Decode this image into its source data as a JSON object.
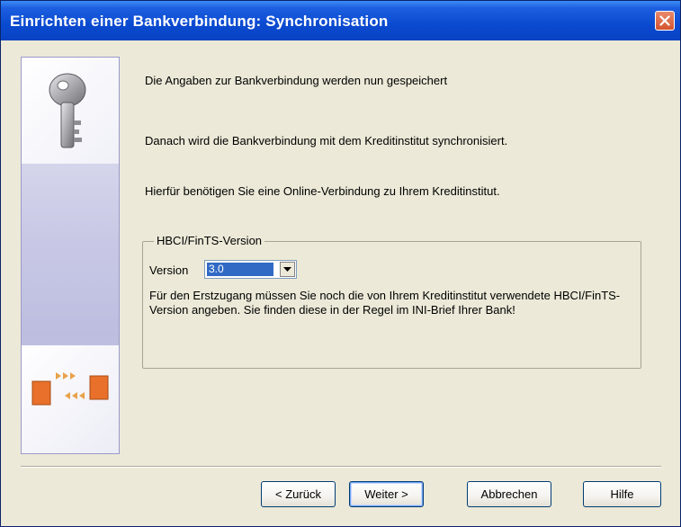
{
  "window": {
    "title": "Einrichten einer Bankverbindung: Synchronisation"
  },
  "icons": {
    "close": "close-icon",
    "key": "key-icon",
    "transfer": "transfer-arrows-icon",
    "dropdown": "chevron-down-icon"
  },
  "content": {
    "line1": "Die Angaben zur Bankverbindung werden nun gespeichert",
    "line2": "Danach wird die Bankverbindung mit dem Kreditinstitut synchronisiert.",
    "line3": "Hierfür benötigen Sie eine Online-Verbindung zu Ihrem Kreditinstitut."
  },
  "group": {
    "legend": "HBCI/FinTS-Version",
    "version_label": "Version",
    "version_value": "3.0",
    "note": "Für den Erstzugang müssen Sie noch die von Ihrem Kreditinstitut verwendete HBCI/FinTS-Version angeben. Sie finden diese in der Regel im INI-Brief Ihrer Bank!"
  },
  "buttons": {
    "back": "< Zurück",
    "next": "Weiter >",
    "cancel": "Abbrechen",
    "help": "Hilfe"
  },
  "colors": {
    "titlebar": "#0a4ad0",
    "close": "#d3532e",
    "selection": "#316ac5",
    "dialog_bg": "#ece9d8"
  }
}
